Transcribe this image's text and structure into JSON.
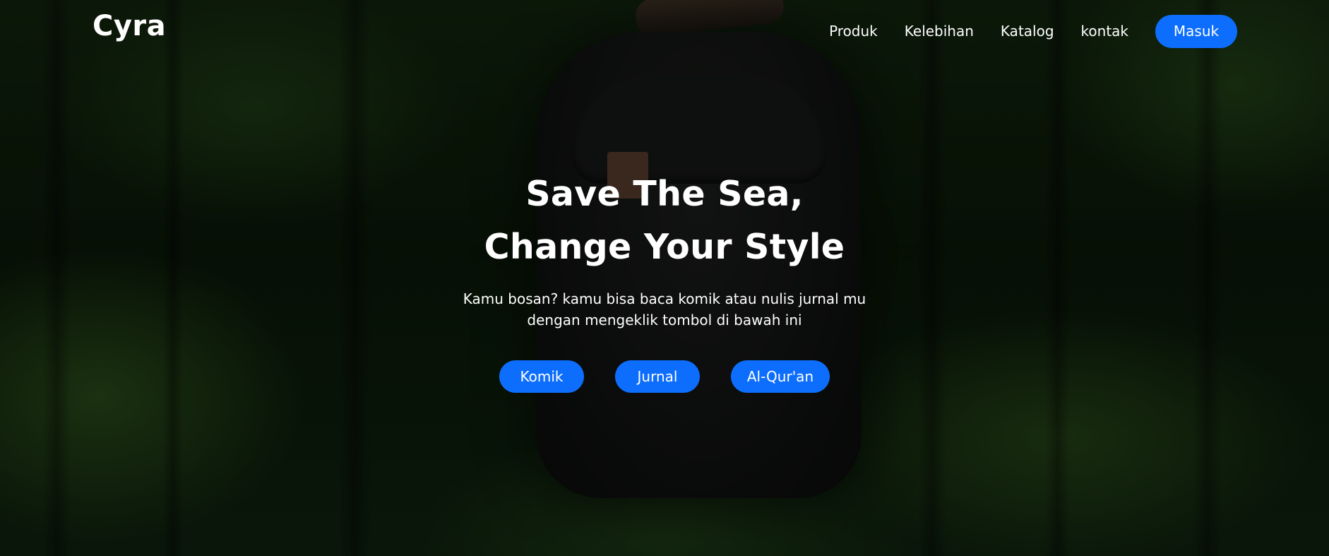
{
  "navbar": {
    "brand": "Cyra",
    "links": [
      "Produk",
      "Kelebihan",
      "Katalog",
      "kontak"
    ],
    "login_label": "Masuk"
  },
  "hero": {
    "title_line1": "Save The Sea,",
    "title_line2": "Change Your Style",
    "subtitle_line1": "Kamu bosan? kamu bisa baca komik atau nulis jurnal mu",
    "subtitle_line2": "dengan mengeklik tombol di bawah ini",
    "buttons": [
      "Komik",
      "Jurnal",
      "Al-Qur'an"
    ]
  },
  "colors": {
    "accent": "#0d6efd",
    "text": "#ffffff",
    "background": "#0f1d0c"
  }
}
